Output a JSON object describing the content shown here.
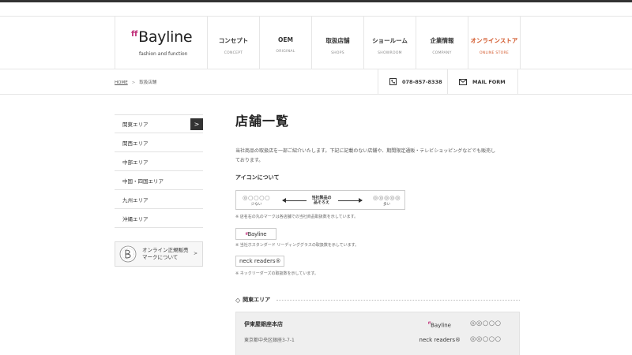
{
  "brand": {
    "logo_prefix": "ff",
    "logo_name": "Bayline",
    "tagline": "fashion and function",
    "accent_color": "#d2572a",
    "logo_color": "#c0307a"
  },
  "nav": {
    "items": [
      {
        "label": "コンセプト",
        "sub": "CONCEPT"
      },
      {
        "label": "OEM",
        "sub": "ORIGINAL"
      },
      {
        "label": "取扱店舗",
        "sub": "SHOPS"
      },
      {
        "label": "ショールーム",
        "sub": "SHOWROOM"
      },
      {
        "label": "企業情報",
        "sub": "COMPANY"
      },
      {
        "label": "オンラインストア",
        "sub": "ONLINE STORE"
      }
    ]
  },
  "breadcrumb": {
    "home": "HOME",
    "separator": ">",
    "current": "取扱店舗"
  },
  "contact": {
    "tel": "078-857-8338",
    "mail": "MAIL FORM",
    "tel_icon": "phone-icon",
    "mail_icon": "mail-icon"
  },
  "sidebar": {
    "items": [
      {
        "label": "関東エリア"
      },
      {
        "label": "関西エリア"
      },
      {
        "label": "中部エリア"
      },
      {
        "label": "中国・四国エリア"
      },
      {
        "label": "九州エリア"
      },
      {
        "label": "沖縄エリア"
      }
    ],
    "online_line1": "オンライン正規販売",
    "online_line2": "マークについて",
    "active_arrow": ">",
    "caret": ">"
  },
  "main": {
    "title": "店舗一覧",
    "intro": "当社商品の取扱店を一部ご紹介いたします。下記に記載のない店舗や、期間限定通販・テレビショッピングなどでも販売しております。",
    "icon_heading": "アイコンについて",
    "legend": {
      "left_dots": "◎○○○○",
      "left_caption": "少ない",
      "middle_line1": "当社製品の",
      "middle_line2": "品そろえ",
      "right_dots": "◎◎◎◎◎",
      "right_caption": "多い"
    },
    "note1": "※ 店名右の丸のマークは各店舗での当社商品取扱数を示しています。",
    "tag_bayline": "Bayline",
    "tag_bayline_prefix": "ff",
    "note2": "※ 当社ホスタンダード リーディンググラスの取扱数を示しています。",
    "tag_neck": "neck readers",
    "tag_neck_mark": "®",
    "note3": "※ ネックリーダーズの取扱数を示しています。"
  },
  "region": {
    "diamond": "◇",
    "title": "関東エリア",
    "stores": [
      {
        "name": "伊東屋銀座本店",
        "address": "東京都中央区銀座3-7-1",
        "tag1_prefix": "ff",
        "tag1": "Bayline",
        "dots1": "◎◎○○○",
        "tag2": "neck readers",
        "tag2_mark": "®",
        "dots2": "◎◎○○○"
      }
    ]
  }
}
